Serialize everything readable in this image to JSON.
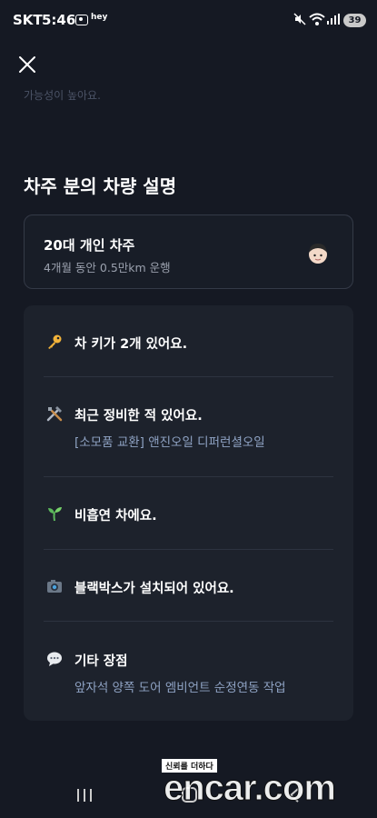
{
  "status_bar": {
    "carrier": "SKT",
    "time": "5:46",
    "hey_label": "hey",
    "battery": "39"
  },
  "top": {
    "faded_text": "가능성이 높아요."
  },
  "section_title": "차주 분의 차량 설명",
  "owner": {
    "name": "20대 개인 차주",
    "sub": "4개월 동안 0.5만km 운행",
    "avatar_icon": "person-emoji-icon"
  },
  "features": [
    {
      "icon": "key-icon",
      "title": "차 키가 2개 있어요.",
      "sub": ""
    },
    {
      "icon": "tools-icon",
      "title": "최근 정비한 적 있어요.",
      "sub": "[소모품 교환] 앤진오일 디퍼런셜오일"
    },
    {
      "icon": "seedling-icon",
      "title": "비흡연 차에요.",
      "sub": ""
    },
    {
      "icon": "camera-icon",
      "title": "블랙박스가 설치되어 있어요.",
      "sub": ""
    },
    {
      "icon": "speech-bubble-icon",
      "title": "기타 장점",
      "sub": "앞자석 양쪽 도어 엠비언트 순정연동 작업"
    }
  ],
  "watermark": {
    "tag": "신뢰를 더하다",
    "logo": "encar.com"
  },
  "colors": {
    "background": "#151923",
    "card": "#1d222c",
    "subtext_blue": "#8fa3c4"
  }
}
